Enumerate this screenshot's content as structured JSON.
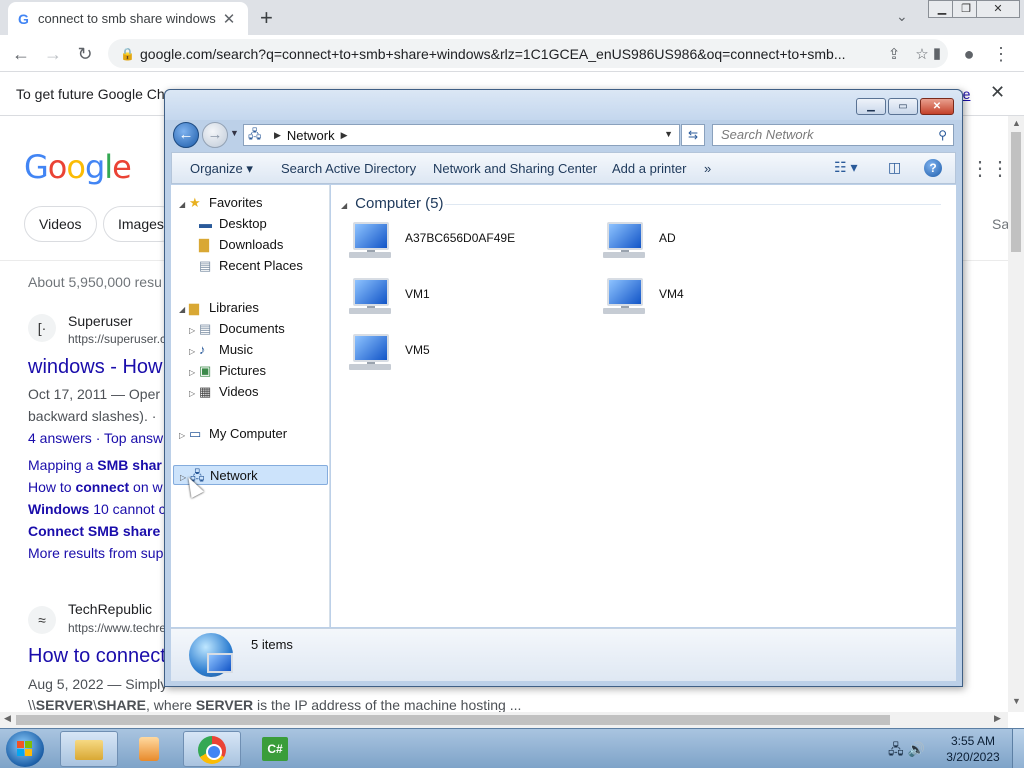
{
  "chrome": {
    "tab_title": "connect to smb share windows -",
    "tab_icon": "G",
    "url": "google.com/search?q=connect+to+smb+share+windows&rlz=1C1GCEA_enUS986US986&oq=connect+to+smb...",
    "infobar_text": "To get future Google Chro",
    "infobar_link": "re"
  },
  "google": {
    "logo": [
      "G",
      "o",
      "o",
      "g",
      "l",
      "e"
    ],
    "chips": [
      "Videos",
      "Images"
    ],
    "chip_more": "Sa",
    "stats": "About 5,950,000 resu",
    "results": [
      {
        "site_icon": "[·",
        "site_name": "Superuser",
        "site_url": "https://superuser.c",
        "title": "windows - How",
        "date_text": "Oct 17, 2011 — Oper",
        "snippet2": "backward slashes). ·",
        "answers": "4 answers · Top answ",
        "links": [
          {
            "pre": "Mapping a ",
            "bold": "SMB shar"
          },
          {
            "pre": "How to ",
            "bold": "connect",
            "post": " on w"
          },
          {
            "pre": "",
            "bold": "Windows",
            "post": " 10 cannot c"
          },
          {
            "pre": "",
            "bold": "Connect SMB share",
            "post": ""
          }
        ],
        "more": "More results from sup"
      },
      {
        "site_icon": "≈",
        "site_name": "TechRepublic",
        "site_url": "https://www.techre",
        "title": "How to connect",
        "date_text": "Aug 5, 2022 — Simply",
        "bottom_line_pre": "\\\\",
        "bottom_line_b1": "SERVER",
        "bottom_line_mid": "\\",
        "bottom_line_b2": "SHARE",
        "bottom_line_mid2": ", where ",
        "bottom_line_b3": "SERVER",
        "bottom_line_post": " is the IP address of the machine hosting ..."
      }
    ]
  },
  "explorer": {
    "address_crumb": "Network",
    "search_placeholder": "Search Network",
    "commands": [
      "Organize",
      "Search Active Directory",
      "Network and Sharing Center",
      "Add a printer",
      "»"
    ],
    "tree": {
      "favorites": "Favorites",
      "favorite_items": [
        "Desktop",
        "Downloads",
        "Recent Places"
      ],
      "libraries": "Libraries",
      "library_items": [
        "Documents",
        "Music",
        "Pictures",
        "Videos"
      ],
      "my_computer": "My Computer",
      "network": "Network"
    },
    "group_label": "Computer (5)",
    "computers": [
      "A37BC656D0AF49E",
      "AD",
      "VM1",
      "VM4",
      "VM5"
    ],
    "status": "5 items"
  },
  "taskbar": {
    "time": "3:55 AM",
    "date": "3/20/2023",
    "cs_label": "C#"
  },
  "colors": {
    "link": "#1a0dab",
    "explorer_frame": "#bcd0e8",
    "selected": "#cce3fb"
  }
}
